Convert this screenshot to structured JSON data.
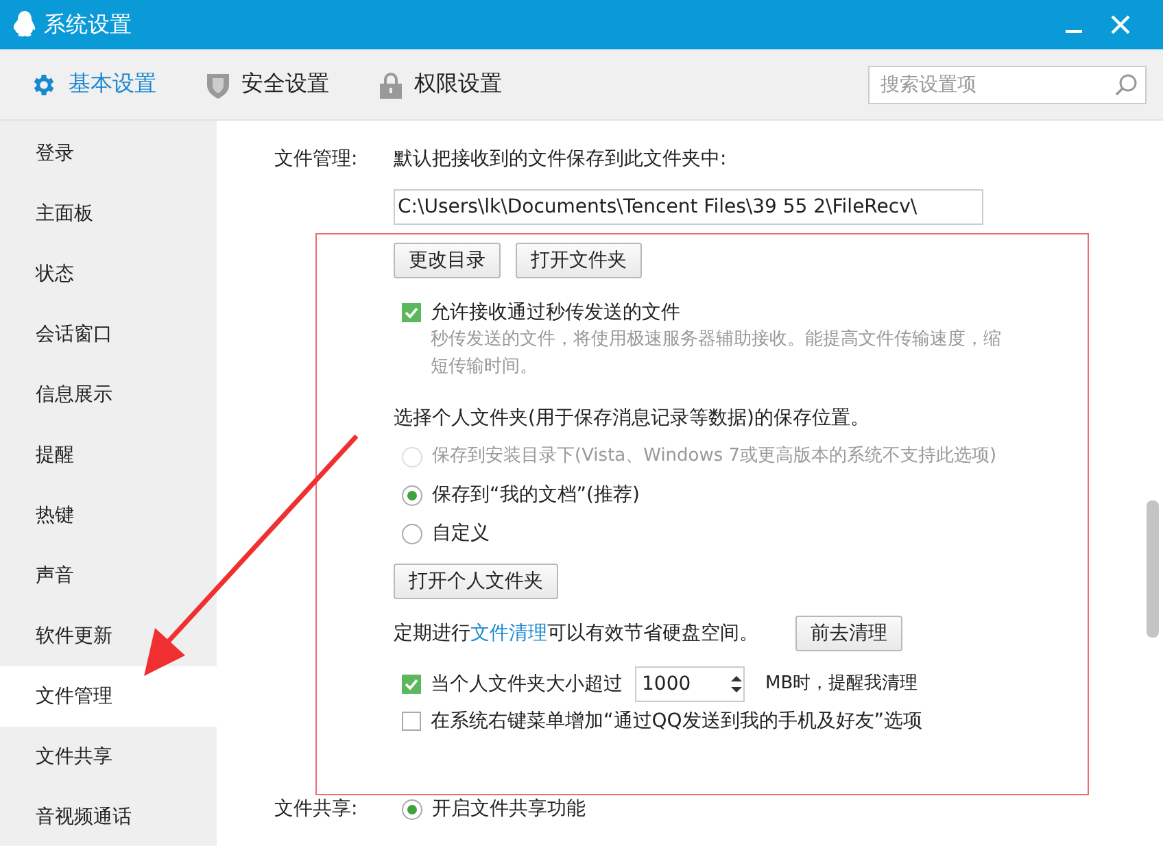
{
  "window": {
    "title": "系统设置"
  },
  "tabs": [
    {
      "label": "基本设置",
      "selected": true,
      "kind": "gear"
    },
    {
      "label": "安全设置",
      "selected": false,
      "kind": "shield"
    },
    {
      "label": "权限设置",
      "selected": false,
      "kind": "lock"
    }
  ],
  "search": {
    "placeholder": "搜索设置项"
  },
  "sidebar": {
    "items": [
      {
        "label": "登录",
        "selected": false
      },
      {
        "label": "主面板",
        "selected": false
      },
      {
        "label": "状态",
        "selected": false
      },
      {
        "label": "会话窗口",
        "selected": false
      },
      {
        "label": "信息展示",
        "selected": false
      },
      {
        "label": "提醒",
        "selected": false
      },
      {
        "label": "热键",
        "selected": false
      },
      {
        "label": "声音",
        "selected": false
      },
      {
        "label": "软件更新",
        "selected": false
      },
      {
        "label": "文件管理",
        "selected": true
      },
      {
        "label": "文件共享",
        "selected": false
      },
      {
        "label": "音视频通话",
        "selected": false
      }
    ]
  },
  "file_management": {
    "label": "文件管理:",
    "intro": "默认把接收到的文件保存到此文件夹中:",
    "path": "C:\\Users\\lk\\Documents\\Tencent Files\\39 55 2\\FileRecv\\",
    "buttons": [
      "更改目录",
      "打开文件夹"
    ],
    "fast_transfer": {
      "label": "允许接收通过秒传发送的文件",
      "checked": true,
      "hint": "秒传发送的文件，将使用极速服务器辅助接收。能提高文件传输速度，缩短传输时间。"
    },
    "personal_folder": {
      "heading": "选择个人文件夹(用于保存消息记录等数据)的保存位置。",
      "options": [
        {
          "label": "保存到安装目录下(Vista、Windows 7或更高版本的系统不支持此选项)",
          "selected": false,
          "disabled": true
        },
        {
          "label": "保存到“我的文档”(推荐)",
          "selected": true,
          "disabled": false
        },
        {
          "label": "自定义",
          "selected": false,
          "disabled": false
        }
      ],
      "button": "打开个人文件夹"
    },
    "cleanup": {
      "before": "定期进行",
      "link": "文件清理",
      "after": "可以有效节省硬盘空间。",
      "button": "前去清理"
    },
    "size_limit": {
      "label": "当个人文件夹大小超过",
      "checked": true,
      "value": "1000",
      "unit": "MB时，提醒我清理"
    },
    "context_menu": {
      "label": "在系统右键菜单增加“通过QQ发送到我的手机及好友”选项",
      "checked": false
    }
  },
  "file_sharing": {
    "label": "文件共享:",
    "options": [
      {
        "label": "开启文件共享功能",
        "selected": true
      }
    ]
  }
}
